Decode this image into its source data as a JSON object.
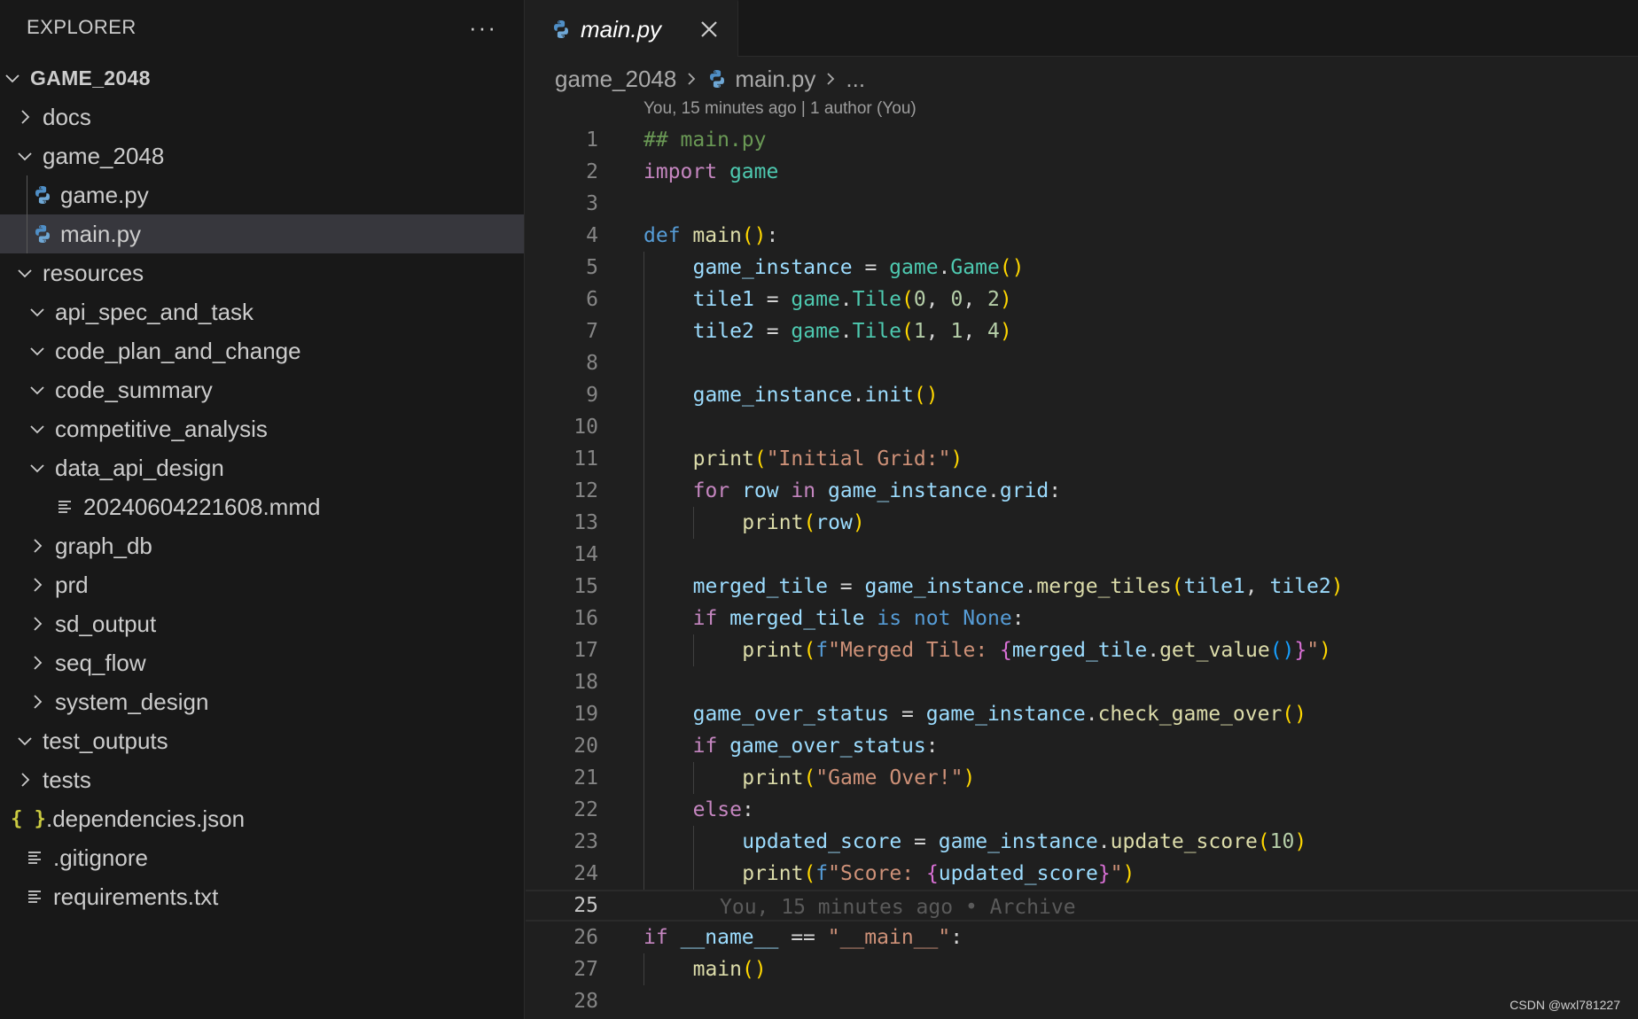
{
  "explorer": {
    "title": "EXPLORER",
    "more": "···",
    "items": [
      {
        "label": "GAME_2048",
        "kind": "root",
        "depth": 0,
        "expanded": true
      },
      {
        "label": "docs",
        "kind": "folder",
        "depth": 1,
        "expanded": false
      },
      {
        "label": "game_2048",
        "kind": "folder",
        "depth": 1,
        "expanded": true
      },
      {
        "label": "game.py",
        "kind": "python",
        "depth": 2
      },
      {
        "label": "main.py",
        "kind": "python",
        "depth": 2,
        "selected": true
      },
      {
        "label": "resources",
        "kind": "folder",
        "depth": 1,
        "expanded": true
      },
      {
        "label": "api_spec_and_task",
        "kind": "folder",
        "depth": 2,
        "expanded": true
      },
      {
        "label": "code_plan_and_change",
        "kind": "folder",
        "depth": 2,
        "expanded": true
      },
      {
        "label": "code_summary",
        "kind": "folder",
        "depth": 2,
        "expanded": true
      },
      {
        "label": "competitive_analysis",
        "kind": "folder",
        "depth": 2,
        "expanded": true
      },
      {
        "label": "data_api_design",
        "kind": "folder",
        "depth": 2,
        "expanded": true
      },
      {
        "label": "20240604221608.mmd",
        "kind": "text",
        "depth": 3
      },
      {
        "label": "graph_db",
        "kind": "folder",
        "depth": 2,
        "expanded": false
      },
      {
        "label": "prd",
        "kind": "folder",
        "depth": 2,
        "expanded": false
      },
      {
        "label": "sd_output",
        "kind": "folder",
        "depth": 2,
        "expanded": false
      },
      {
        "label": "seq_flow",
        "kind": "folder",
        "depth": 2,
        "expanded": false
      },
      {
        "label": "system_design",
        "kind": "folder",
        "depth": 2,
        "expanded": false
      },
      {
        "label": "test_outputs",
        "kind": "folder",
        "depth": 1,
        "expanded": true
      },
      {
        "label": "tests",
        "kind": "folder",
        "depth": 1,
        "expanded": false
      },
      {
        "label": ".dependencies.json",
        "kind": "json",
        "depth": 1
      },
      {
        "label": ".gitignore",
        "kind": "text",
        "depth": 1
      },
      {
        "label": "requirements.txt",
        "kind": "text",
        "depth": 1
      }
    ]
  },
  "tab": {
    "label": "main.py",
    "icon": "python-icon"
  },
  "breadcrumb": {
    "folder": "game_2048",
    "file": "main.py",
    "more": "..."
  },
  "blame": {
    "header": "You, 15 minutes ago | 1 author (You)",
    "inline": "You, 15 minutes ago • Archive"
  },
  "current_line": 25,
  "colors": {
    "keyword": "#569cd6",
    "control": "#c586c0",
    "string": "#ce9178",
    "function": "#dcdcaa",
    "variable": "#9cdcfe",
    "module": "#4ec9b0",
    "number": "#b5cea8",
    "comment": "#6a9955",
    "bracket": "#ffd700",
    "bracket2": "#da70d6",
    "bracket3": "#179fff",
    "plain": "#d4d4d4"
  },
  "code": [
    {
      "n": "1",
      "indent": 0,
      "tokens": [
        [
          "comment",
          "## main.py"
        ]
      ]
    },
    {
      "n": "2",
      "indent": 0,
      "tokens": [
        [
          "control",
          "import"
        ],
        [
          "plain",
          " "
        ],
        [
          "module",
          "game"
        ]
      ]
    },
    {
      "n": "3",
      "indent": 0,
      "tokens": []
    },
    {
      "n": "4",
      "indent": 0,
      "tokens": [
        [
          "keyword",
          "def"
        ],
        [
          "plain",
          " "
        ],
        [
          "function",
          "main"
        ],
        [
          "bracket",
          "()"
        ],
        [
          "plain",
          ":"
        ]
      ]
    },
    {
      "n": "5",
      "indent": 1,
      "tokens": [
        [
          "variable",
          "game_instance"
        ],
        [
          "plain",
          " = "
        ],
        [
          "module",
          "game"
        ],
        [
          "plain",
          "."
        ],
        [
          "module",
          "Game"
        ],
        [
          "bracket",
          "()"
        ]
      ]
    },
    {
      "n": "6",
      "indent": 1,
      "tokens": [
        [
          "variable",
          "tile1"
        ],
        [
          "plain",
          " = "
        ],
        [
          "module",
          "game"
        ],
        [
          "plain",
          "."
        ],
        [
          "module",
          "Tile"
        ],
        [
          "bracket",
          "("
        ],
        [
          "number",
          "0"
        ],
        [
          "plain",
          ", "
        ],
        [
          "number",
          "0"
        ],
        [
          "plain",
          ", "
        ],
        [
          "number",
          "2"
        ],
        [
          "bracket",
          ")"
        ]
      ]
    },
    {
      "n": "7",
      "indent": 1,
      "tokens": [
        [
          "variable",
          "tile2"
        ],
        [
          "plain",
          " = "
        ],
        [
          "module",
          "game"
        ],
        [
          "plain",
          "."
        ],
        [
          "module",
          "Tile"
        ],
        [
          "bracket",
          "("
        ],
        [
          "number",
          "1"
        ],
        [
          "plain",
          ", "
        ],
        [
          "number",
          "1"
        ],
        [
          "plain",
          ", "
        ],
        [
          "number",
          "4"
        ],
        [
          "bracket",
          ")"
        ]
      ]
    },
    {
      "n": "8",
      "indent": 1,
      "tokens": []
    },
    {
      "n": "9",
      "indent": 1,
      "tokens": [
        [
          "variable",
          "game_instance"
        ],
        [
          "plain",
          "."
        ],
        [
          "variable",
          "init"
        ],
        [
          "bracket",
          "()"
        ]
      ]
    },
    {
      "n": "10",
      "indent": 1,
      "tokens": []
    },
    {
      "n": "11",
      "indent": 1,
      "tokens": [
        [
          "function",
          "print"
        ],
        [
          "bracket",
          "("
        ],
        [
          "string",
          "\"Initial Grid:\""
        ],
        [
          "bracket",
          ")"
        ]
      ]
    },
    {
      "n": "12",
      "indent": 1,
      "tokens": [
        [
          "control",
          "for"
        ],
        [
          "plain",
          " "
        ],
        [
          "variable",
          "row"
        ],
        [
          "plain",
          " "
        ],
        [
          "control",
          "in"
        ],
        [
          "plain",
          " "
        ],
        [
          "variable",
          "game_instance"
        ],
        [
          "plain",
          "."
        ],
        [
          "variable",
          "grid"
        ],
        [
          "plain",
          ":"
        ]
      ]
    },
    {
      "n": "13",
      "indent": 2,
      "tokens": [
        [
          "function",
          "print"
        ],
        [
          "bracket",
          "("
        ],
        [
          "variable",
          "row"
        ],
        [
          "bracket",
          ")"
        ]
      ]
    },
    {
      "n": "14",
      "indent": 1,
      "tokens": []
    },
    {
      "n": "15",
      "indent": 1,
      "tokens": [
        [
          "variable",
          "merged_tile"
        ],
        [
          "plain",
          " = "
        ],
        [
          "variable",
          "game_instance"
        ],
        [
          "plain",
          "."
        ],
        [
          "function",
          "merge_tiles"
        ],
        [
          "bracket",
          "("
        ],
        [
          "variable",
          "tile1"
        ],
        [
          "plain",
          ", "
        ],
        [
          "variable",
          "tile2"
        ],
        [
          "bracket",
          ")"
        ]
      ]
    },
    {
      "n": "16",
      "indent": 1,
      "tokens": [
        [
          "control",
          "if"
        ],
        [
          "plain",
          " "
        ],
        [
          "variable",
          "merged_tile"
        ],
        [
          "plain",
          " "
        ],
        [
          "keyword",
          "is not"
        ],
        [
          "plain",
          " "
        ],
        [
          "keyword",
          "None"
        ],
        [
          "plain",
          ":"
        ]
      ]
    },
    {
      "n": "17",
      "indent": 2,
      "tokens": [
        [
          "function",
          "print"
        ],
        [
          "bracket",
          "("
        ],
        [
          "keyword",
          "f"
        ],
        [
          "string",
          "\"Merged Tile: "
        ],
        [
          "bracket2",
          "{"
        ],
        [
          "variable",
          "merged_tile"
        ],
        [
          "plain",
          "."
        ],
        [
          "function",
          "get_value"
        ],
        [
          "bracket3",
          "()"
        ],
        [
          "bracket2",
          "}"
        ],
        [
          "string",
          "\""
        ],
        [
          "bracket",
          ")"
        ]
      ]
    },
    {
      "n": "18",
      "indent": 1,
      "tokens": []
    },
    {
      "n": "19",
      "indent": 1,
      "tokens": [
        [
          "variable",
          "game_over_status"
        ],
        [
          "plain",
          " = "
        ],
        [
          "variable",
          "game_instance"
        ],
        [
          "plain",
          "."
        ],
        [
          "function",
          "check_game_over"
        ],
        [
          "bracket",
          "()"
        ]
      ]
    },
    {
      "n": "20",
      "indent": 1,
      "tokens": [
        [
          "control",
          "if"
        ],
        [
          "plain",
          " "
        ],
        [
          "variable",
          "game_over_status"
        ],
        [
          "plain",
          ":"
        ]
      ]
    },
    {
      "n": "21",
      "indent": 2,
      "tokens": [
        [
          "function",
          "print"
        ],
        [
          "bracket",
          "("
        ],
        [
          "string",
          "\"Game Over!\""
        ],
        [
          "bracket",
          ")"
        ]
      ]
    },
    {
      "n": "22",
      "indent": 1,
      "tokens": [
        [
          "control",
          "else"
        ],
        [
          "plain",
          ":"
        ]
      ]
    },
    {
      "n": "23",
      "indent": 2,
      "tokens": [
        [
          "variable",
          "updated_score"
        ],
        [
          "plain",
          " = "
        ],
        [
          "variable",
          "game_instance"
        ],
        [
          "plain",
          "."
        ],
        [
          "function",
          "update_score"
        ],
        [
          "bracket",
          "("
        ],
        [
          "number",
          "10"
        ],
        [
          "bracket",
          ")"
        ]
      ]
    },
    {
      "n": "24",
      "indent": 2,
      "tokens": [
        [
          "function",
          "print"
        ],
        [
          "bracket",
          "("
        ],
        [
          "keyword",
          "f"
        ],
        [
          "string",
          "\"Score: "
        ],
        [
          "bracket2",
          "{"
        ],
        [
          "variable",
          "updated_score"
        ],
        [
          "bracket2",
          "}"
        ],
        [
          "string",
          "\""
        ],
        [
          "bracket",
          ")"
        ]
      ]
    },
    {
      "n": "25",
      "indent": 0,
      "tokens": [],
      "ghost": true
    },
    {
      "n": "26",
      "indent": 0,
      "tokens": [
        [
          "control",
          "if"
        ],
        [
          "plain",
          " "
        ],
        [
          "variable",
          "__name__"
        ],
        [
          "plain",
          " == "
        ],
        [
          "string",
          "\"__main__\""
        ],
        [
          "plain",
          ":"
        ]
      ]
    },
    {
      "n": "27",
      "indent": 1,
      "tokens": [
        [
          "function",
          "main"
        ],
        [
          "bracket",
          "()"
        ]
      ]
    },
    {
      "n": "28",
      "indent": 0,
      "tokens": []
    }
  ],
  "watermark": "CSDN @wxl781227"
}
